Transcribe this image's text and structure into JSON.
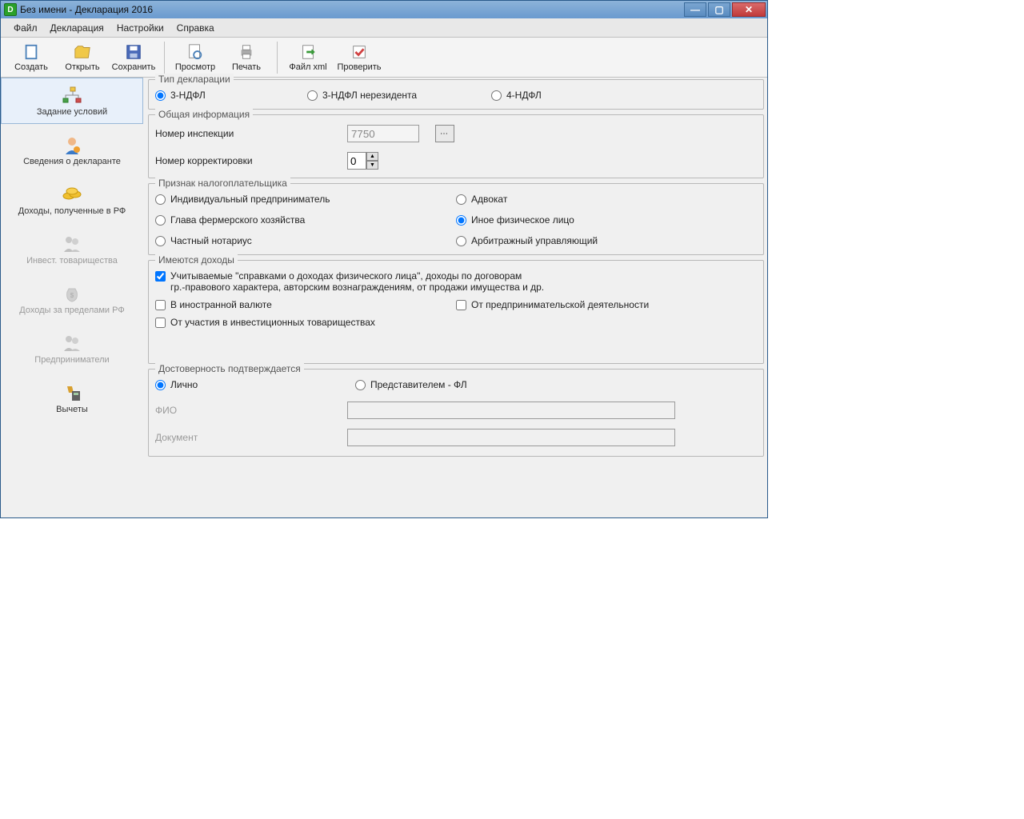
{
  "window": {
    "title": "Без имени - Декларация 2016"
  },
  "menu": {
    "file": "Файл",
    "decl": "Декларация",
    "settings": "Настройки",
    "help": "Справка"
  },
  "toolbar": {
    "create": "Создать",
    "open": "Открыть",
    "save": "Сохранить",
    "preview": "Просмотр",
    "print": "Печать",
    "filexml": "Файл xml",
    "check": "Проверить"
  },
  "sidebar": {
    "items": [
      {
        "label": "Задание условий",
        "selected": true,
        "disabled": false
      },
      {
        "label": "Сведения о декларанте",
        "selected": false,
        "disabled": false
      },
      {
        "label": "Доходы, полученные в РФ",
        "selected": false,
        "disabled": false
      },
      {
        "label": "Инвест. товарищества",
        "selected": false,
        "disabled": true
      },
      {
        "label": "Доходы за пределами РФ",
        "selected": false,
        "disabled": true
      },
      {
        "label": "Предприниматели",
        "selected": false,
        "disabled": true
      },
      {
        "label": "Вычеты",
        "selected": false,
        "disabled": false
      }
    ]
  },
  "decl_type": {
    "legend": "Тип декларации",
    "opt1": "3-НДФЛ",
    "opt2": "3-НДФЛ нерезидента",
    "opt3": "4-НДФЛ",
    "selected": "opt1"
  },
  "general": {
    "legend": "Общая информация",
    "inspection_lbl": "Номер инспекции",
    "inspection_val": "7750",
    "correction_lbl": "Номер корректировки",
    "correction_val": "0"
  },
  "taxpayer": {
    "legend": "Признак налогоплательщика",
    "r1": "Индивидуальный предприниматель",
    "r2": "Адвокат",
    "r3": "Глава фермерского хозяйства",
    "r4": "Иное физическое лицо",
    "r5": "Частный нотариус",
    "r6": "Арбитражный управляющий",
    "selected": "r4"
  },
  "incomes": {
    "legend": "Имеются доходы",
    "c1": "Учитываемые \"справками о доходах физического лица\", доходы по договорам",
    "c1b": "гр.-правового характера, авторским вознаграждениям, от продажи имущества и др.",
    "c2": "В иностранной валюте",
    "c3": "От предпринимательской деятельности",
    "c4": "От участия в инвестиционных товариществах"
  },
  "confirm": {
    "legend": "Достоверность подтверждается",
    "r1": "Лично",
    "r2": "Представителем - ФЛ",
    "fio": "ФИО",
    "doc": "Документ"
  }
}
